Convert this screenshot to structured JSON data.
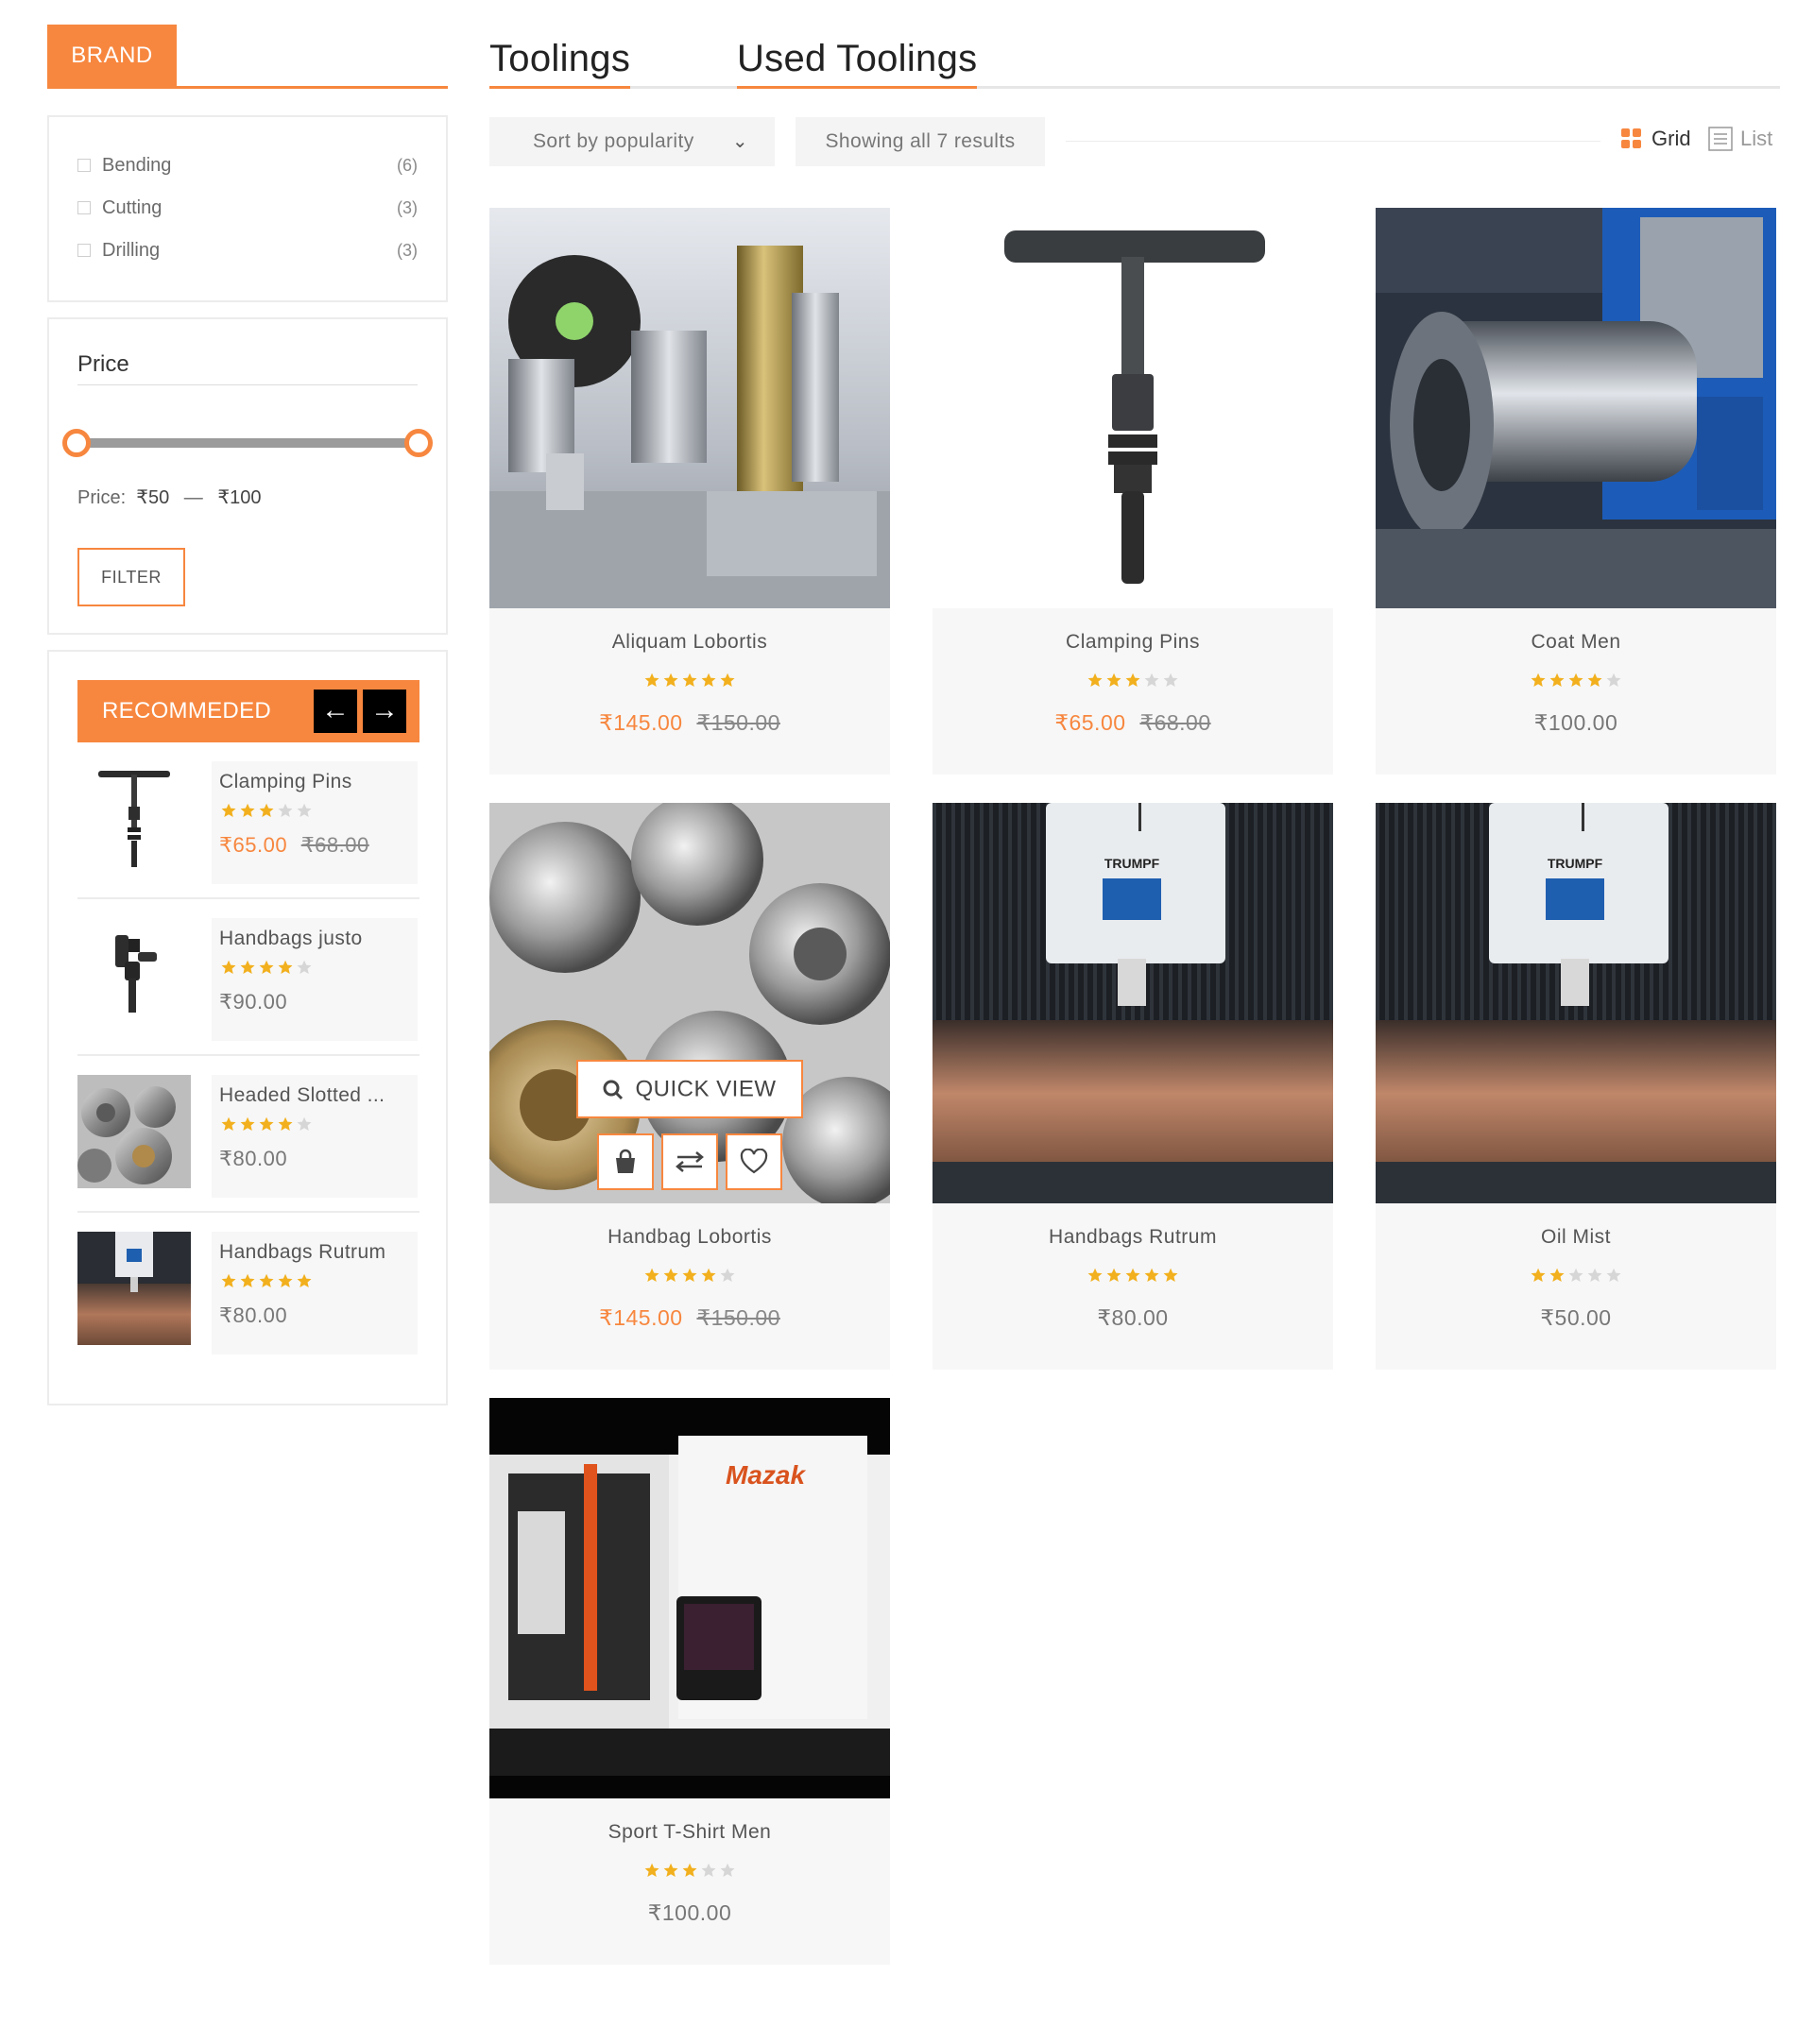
{
  "sidebar": {
    "brand": {
      "title": "BRAND",
      "items": [
        {
          "label": "Bending",
          "count": "(6)"
        },
        {
          "label": "Cutting",
          "count": "(3)"
        },
        {
          "label": "Drilling",
          "count": "(3)"
        }
      ]
    },
    "price": {
      "title": "Price",
      "label": "Price:",
      "min": "₹50",
      "separator": "—",
      "max": "₹100",
      "filter_label": "FILTER"
    },
    "recommended": {
      "title": "RECOMMEDED",
      "prev_icon": "arrow-left-icon",
      "next_icon": "arrow-right-icon",
      "items": [
        {
          "name": "Clamping Pins",
          "rating": 3,
          "price": "₹65.00",
          "old_price": "₹68.00"
        },
        {
          "name": "Handbags justo",
          "rating": 4,
          "price": "₹90.00",
          "old_price": ""
        },
        {
          "name": "Headed Slotted ...",
          "rating": 4,
          "price": "₹80.00",
          "old_price": ""
        },
        {
          "name": "Handbags Rutrum",
          "rating": 5,
          "price": "₹80.00",
          "old_price": ""
        }
      ]
    }
  },
  "tabs": [
    {
      "label": "Toolings"
    },
    {
      "label": "Used Toolings"
    }
  ],
  "toolbar": {
    "sort_label": "Sort by popularity",
    "showing": "Showing all 7 results",
    "grid_label": "Grid",
    "list_label": "List"
  },
  "products": [
    {
      "name": "Aliquam Lobortis",
      "rating": 5,
      "price": "₹145.00",
      "old_price": "₹150.00"
    },
    {
      "name": "Clamping Pins",
      "rating": 3,
      "price": "₹65.00",
      "old_price": "₹68.00"
    },
    {
      "name": "Coat Men",
      "rating": 4,
      "price": "₹100.00",
      "old_price": ""
    },
    {
      "name": "Handbag Lobortis",
      "rating": 4,
      "price": "₹145.00",
      "old_price": "₹150.00"
    },
    {
      "name": "Handbags Rutrum",
      "rating": 5,
      "price": "₹80.00",
      "old_price": ""
    },
    {
      "name": "Oil Mist",
      "rating": 2,
      "price": "₹50.00",
      "old_price": ""
    },
    {
      "name": "Sport T-Shirt Men",
      "rating": 3,
      "price": "₹100.00",
      "old_price": ""
    }
  ],
  "quick_view": {
    "label": "QUICK VIEW",
    "search_icon": "search-icon",
    "cart_icon": "shopping-bag-icon",
    "compare_icon": "compare-arrows-icon",
    "wishlist_icon": "heart-icon"
  },
  "image_text": {
    "trumpf": "TRUMPF",
    "mazak": "Mazak"
  },
  "colors": {
    "accent": "#f7873f",
    "star": "#f2b01e",
    "star_empty": "#d6d6d6"
  }
}
